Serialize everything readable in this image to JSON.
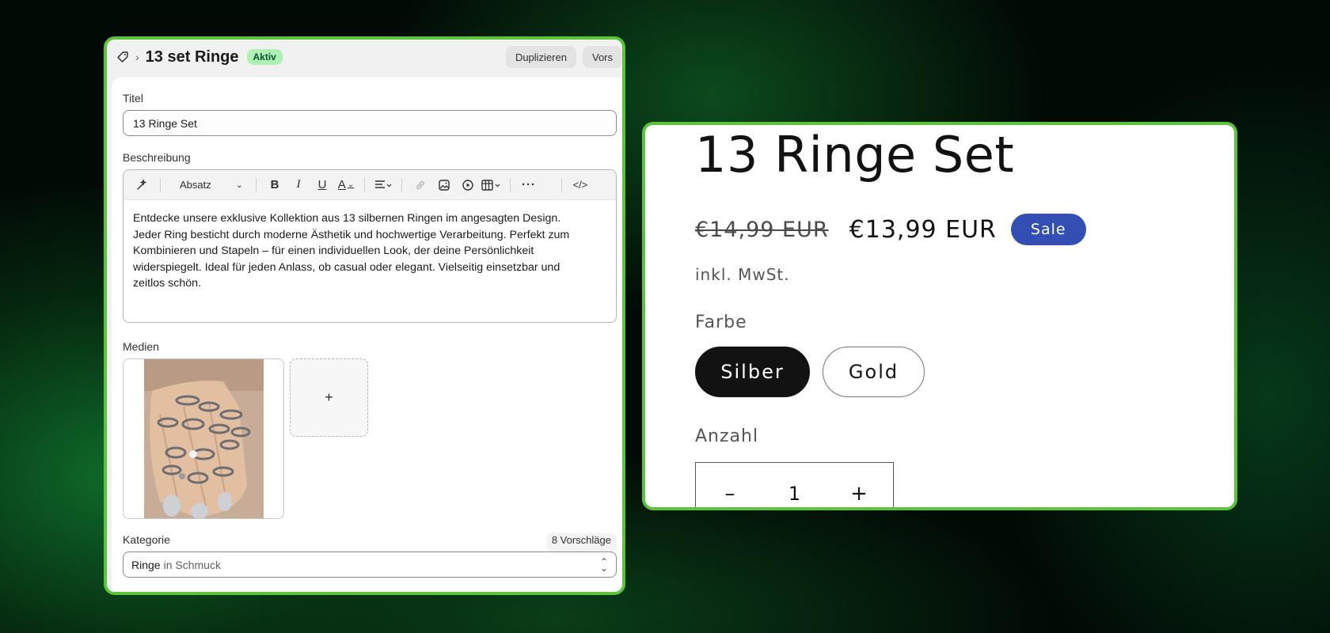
{
  "admin": {
    "title": "13 set Ringe",
    "status": "Aktiv",
    "actions": [
      "Duplizieren",
      "Vors"
    ],
    "title_label": "Titel",
    "title_value": "13 Ringe Set",
    "description_label": "Beschreibung",
    "toolbar": {
      "paragraph_format": "Absatz",
      "icons": [
        "magic-icon",
        "bold-icon",
        "italic-icon",
        "underline-icon",
        "text-color-icon",
        "align-icon",
        "link-icon",
        "image-icon",
        "video-icon",
        "table-icon",
        "more-icon",
        "code-icon"
      ]
    },
    "description_lines": [
      "Entdecke unsere exklusive Kollektion aus 13 silbernen Ringen im angesagten Design.",
      "Jeder Ring besticht durch moderne Ästhetik und hochwertige Verarbeitung. Perfekt zum",
      "Kombinieren und Stapeln – für einen individuellen Look, der deine Persönlichkeit",
      "widerspiegelt. Ideal für jeden Anlass, ob casual oder elegant. Vielseitig einsetzbar und",
      "zeitlos schön."
    ],
    "media_label": "Medien",
    "media_add": "+",
    "category_label": "Kategorie",
    "category_suggestions": "8 Vorschläge",
    "category_value": "Ringe",
    "category_parent": "in Schmuck"
  },
  "store": {
    "product_title": "13 Ringe Set",
    "old_price": "€14,99 EUR",
    "new_price": "€13,99 EUR",
    "sale_badge": "Sale",
    "tax_note": "inkl. MwSt.",
    "color_label": "Farbe",
    "colors": [
      "Silber",
      "Gold"
    ],
    "selected_color": "Silber",
    "quantity_label": "Anzahl",
    "quantity_value": "1",
    "quantity_minus": "–",
    "quantity_plus": "+"
  },
  "colors": {
    "border_accent": "#5cc43c",
    "sale_badge": "#334fb4",
    "status_badge_bg": "#aff0b5"
  }
}
